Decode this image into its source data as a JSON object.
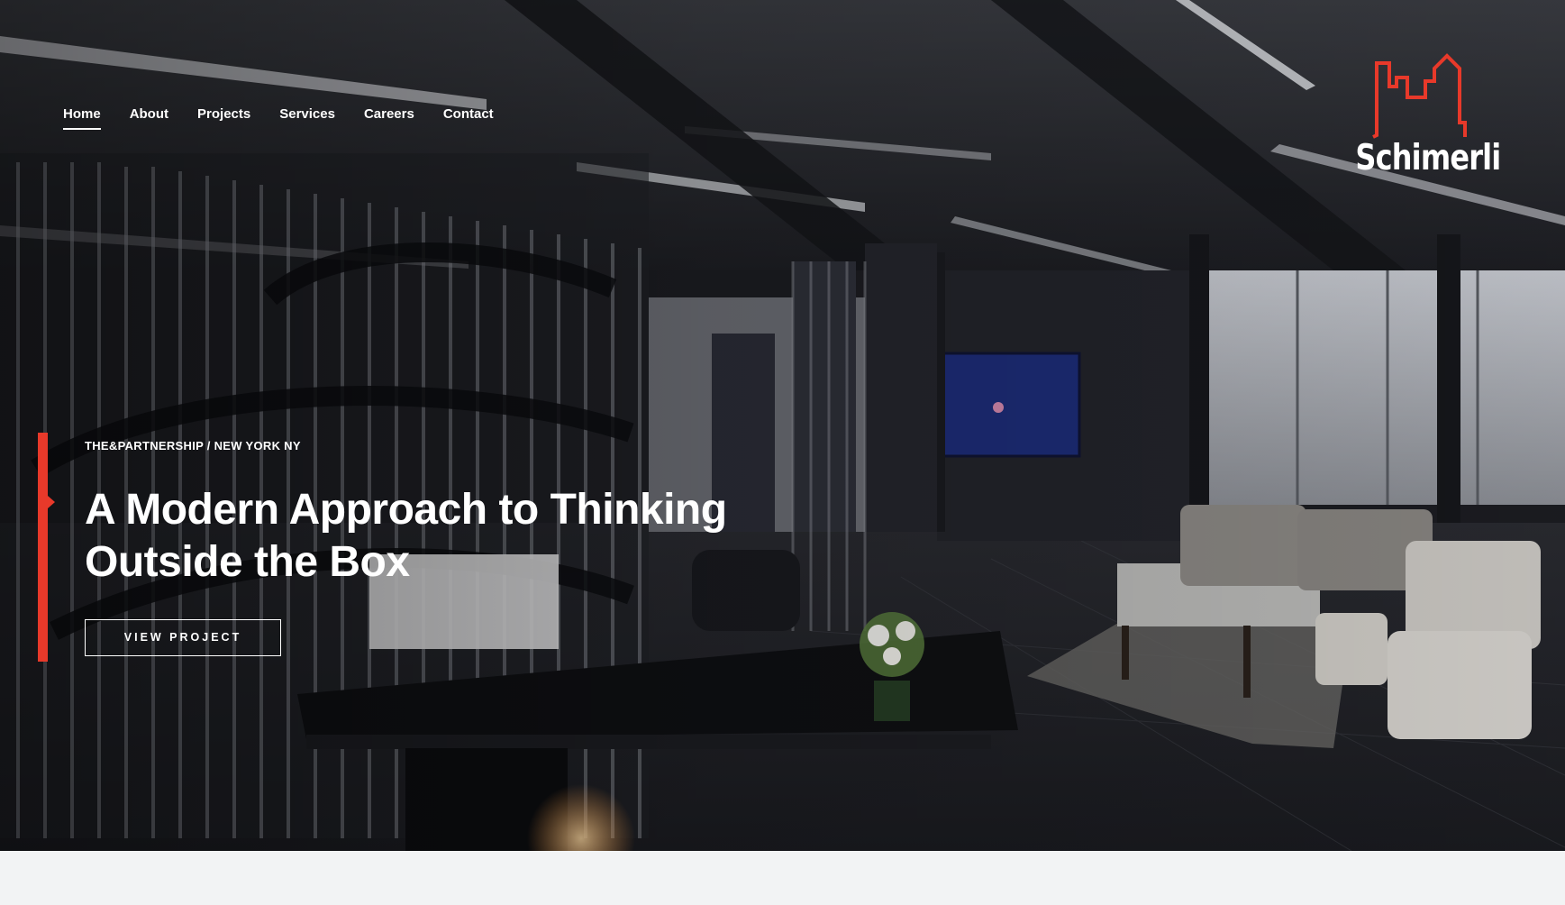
{
  "nav": {
    "items": [
      {
        "label": "Home",
        "active": true
      },
      {
        "label": "About",
        "active": false
      },
      {
        "label": "Projects",
        "active": false
      },
      {
        "label": "Services",
        "active": false
      },
      {
        "label": "Careers",
        "active": false
      },
      {
        "label": "Contact",
        "active": false
      }
    ]
  },
  "logo": {
    "wordmark": "Schimerli",
    "icon": "city-skyline-icon",
    "accent_color": "#e8392a"
  },
  "hero": {
    "eyebrow": "THE&PARTNERSHIP / NEW YORK NY",
    "headline": "A Modern Approach to Thinking Outside the Box",
    "cta_label": "VIEW PROJECT",
    "accent_color": "#e8392a",
    "background": "office-interior-photo"
  }
}
